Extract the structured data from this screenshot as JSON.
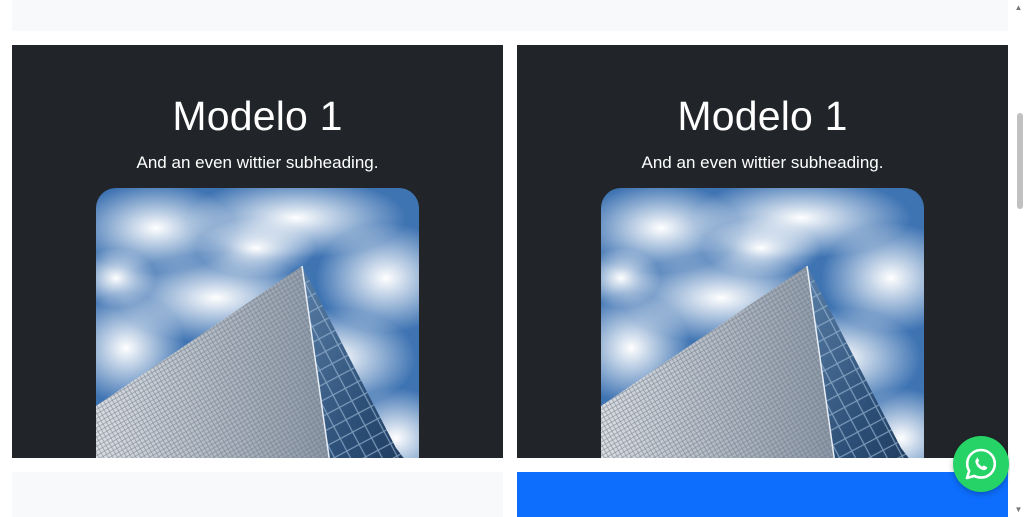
{
  "cards": [
    {
      "title": "Modelo 1",
      "subtitle": "And an even wittier subheading.",
      "image": "skyscraper-and-clouds"
    },
    {
      "title": "Modelo 1",
      "subtitle": "And an even wittier subheading.",
      "image": "skyscraper-and-clouds"
    }
  ],
  "floating_button": {
    "icon": "whatsapp-icon",
    "color": "#25d366"
  },
  "colors": {
    "card_bg": "#212529",
    "light_panel": "#f8f9fa",
    "primary_panel": "#0d6efd"
  }
}
